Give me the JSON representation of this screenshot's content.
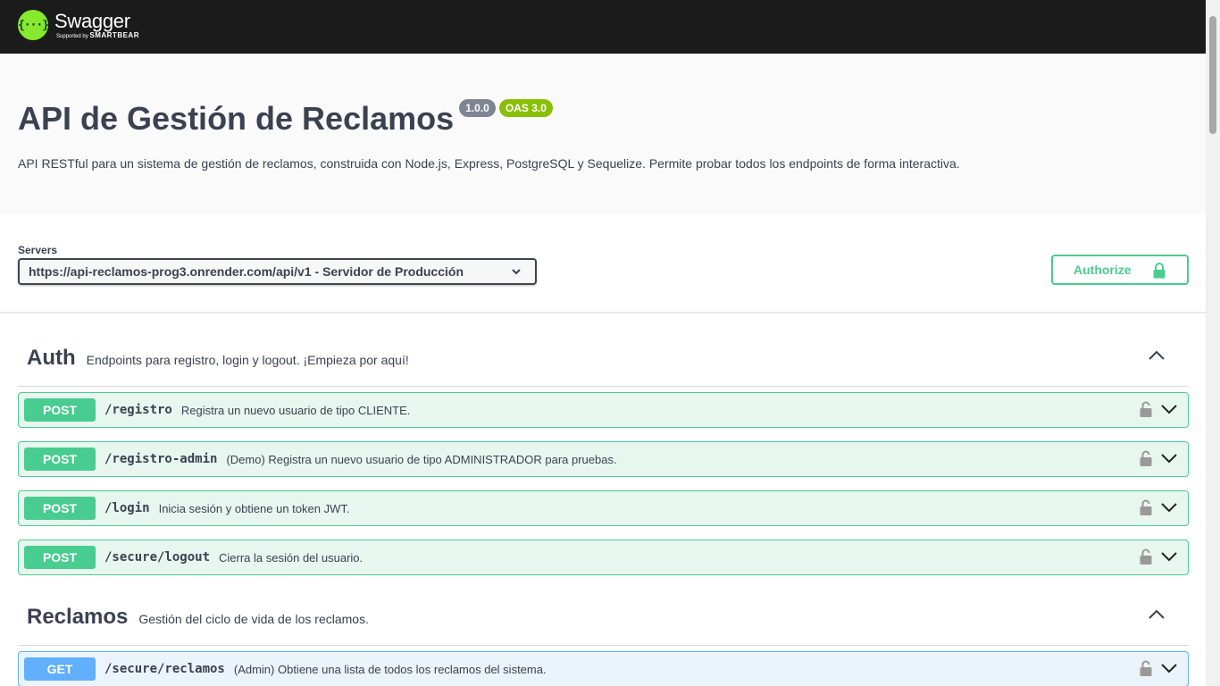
{
  "topbar": {
    "logo_mark": "{···}",
    "logo_name": "Swagger",
    "logo_sub_prefix": "Supported by",
    "logo_sub_brand": "SMARTBEAR"
  },
  "info": {
    "title": "API de Gestión de Reclamos",
    "version_badge": "1.0.0",
    "oas_badge": "OAS 3.0",
    "description": "API RESTful para un sistema de gestión de reclamos, construida con Node.js, Express, PostgreSQL y Sequelize. Permite probar todos los endpoints de forma interactiva."
  },
  "servers": {
    "label": "Servers",
    "selected": "https://api-reclamos-prog3.onrender.com/api/v1 - Servidor de Producción"
  },
  "authorize": {
    "label": "Authorize"
  },
  "sections": [
    {
      "name": "Auth",
      "description": "Endpoints para registro, login y logout. ¡Empieza por aquí!",
      "operations": [
        {
          "method": "POST",
          "path": "/registro",
          "summary": "Registra un nuevo usuario de tipo CLIENTE."
        },
        {
          "method": "POST",
          "path": "/registro-admin",
          "summary": "(Demo) Registra un nuevo usuario de tipo ADMINISTRADOR para pruebas."
        },
        {
          "method": "POST",
          "path": "/login",
          "summary": "Inicia sesión y obtiene un token JWT."
        },
        {
          "method": "POST",
          "path": "/secure/logout",
          "summary": "Cierra la sesión del usuario."
        }
      ]
    },
    {
      "name": "Reclamos",
      "description": "Gestión del ciclo de vida de los reclamos.",
      "operations": [
        {
          "method": "GET",
          "path": "/secure/reclamos",
          "summary": "(Admin) Obtiene una lista de todos los reclamos del sistema."
        }
      ]
    }
  ],
  "colors": {
    "post": "#49cc90",
    "get": "#61affe",
    "topbar": "#1b1b1b",
    "brand": "#85ea2d"
  },
  "icons": {
    "lock": "lock-icon",
    "expand": "chevron-down-icon",
    "collapse": "chevron-up-icon"
  }
}
